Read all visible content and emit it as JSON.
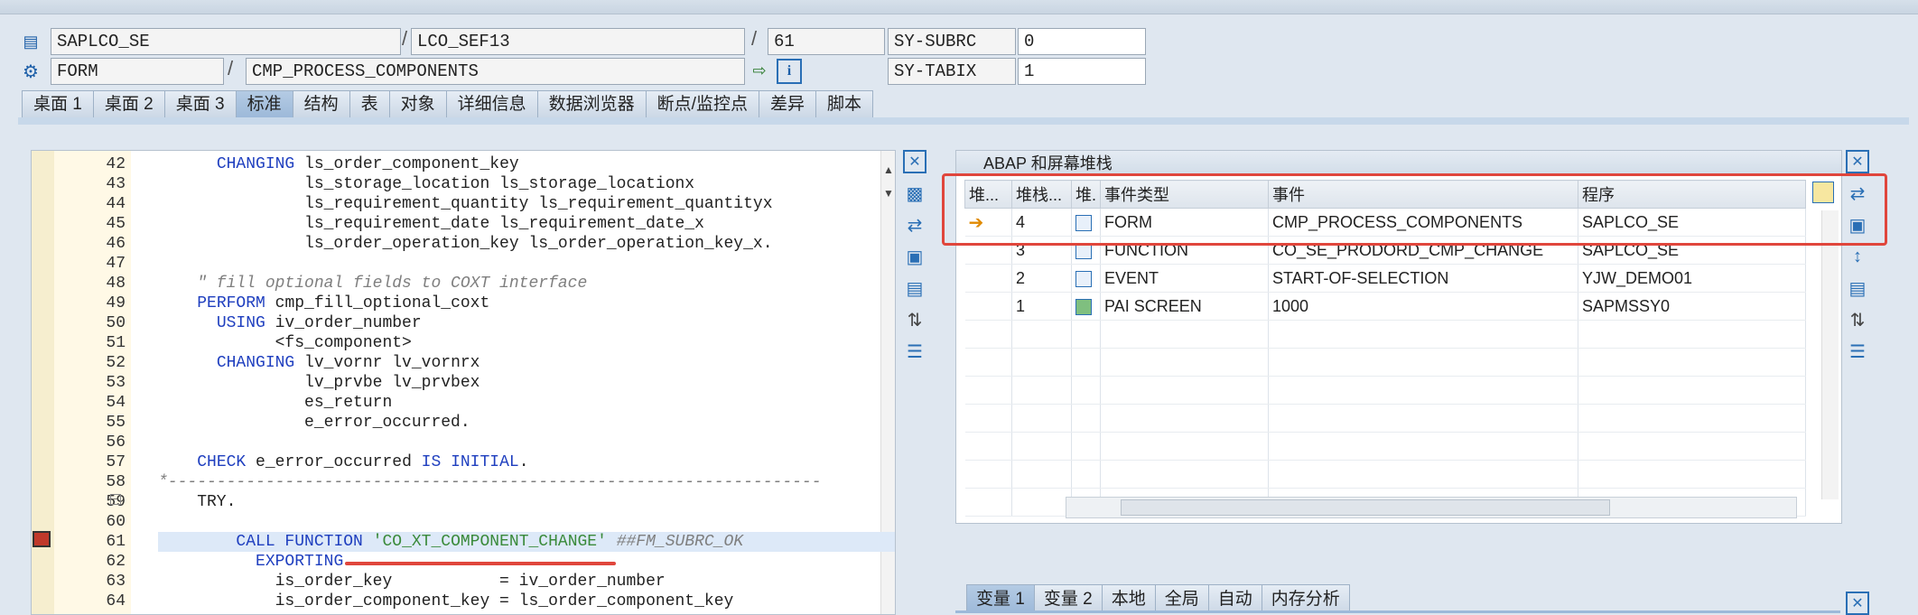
{
  "header": {
    "row1": {
      "program": "SAPLCO_SE",
      "include": "LCO_SEF13",
      "line": "61",
      "sysvar_label": "SY-SUBRC",
      "sysvar_value": "0"
    },
    "row2": {
      "event_type": "FORM",
      "event_name": "CMP_PROCESS_COMPONENTS",
      "sysvar_label": "SY-TABIX",
      "sysvar_value": "1"
    }
  },
  "tabs": [
    "桌面 1",
    "桌面 2",
    "桌面 3",
    "标准",
    "结构",
    "表",
    "对象",
    "详细信息",
    "数据浏览器",
    "断点/监控点",
    "差异",
    "脚本"
  ],
  "active_tab": "标准",
  "editor": {
    "lines": [
      {
        "n": "42",
        "parts": [
          [
            "      ",
            "pl"
          ],
          [
            "CHANGING",
            "kw"
          ],
          [
            " ls_order_component_key",
            "pl"
          ]
        ]
      },
      {
        "n": "43",
        "parts": [
          [
            "               ls_storage_location ls_storage_locationx",
            "pl"
          ]
        ]
      },
      {
        "n": "44",
        "parts": [
          [
            "               ls_requirement_quantity ls_requirement_quantityx",
            "pl"
          ]
        ]
      },
      {
        "n": "45",
        "parts": [
          [
            "               ls_requirement_date ls_requirement_date_x",
            "pl"
          ]
        ]
      },
      {
        "n": "46",
        "parts": [
          [
            "               ls_order_operation_key ls_order_operation_key_x.",
            "pl"
          ]
        ]
      },
      {
        "n": "47",
        "parts": []
      },
      {
        "n": "48",
        "parts": [
          [
            "    \" fill optional fields to COXT interface",
            "cm"
          ]
        ]
      },
      {
        "n": "49",
        "parts": [
          [
            "    ",
            "pl"
          ],
          [
            "PERFORM",
            "kw"
          ],
          [
            " cmp_fill_optional_coxt",
            "pl"
          ]
        ]
      },
      {
        "n": "50",
        "parts": [
          [
            "      ",
            "pl"
          ],
          [
            "USING",
            "kw"
          ],
          [
            " iv_order_number",
            "pl"
          ]
        ]
      },
      {
        "n": "51",
        "parts": [
          [
            "            <fs_component>",
            "pl"
          ]
        ]
      },
      {
        "n": "52",
        "parts": [
          [
            "      ",
            "pl"
          ],
          [
            "CHANGING",
            "kw"
          ],
          [
            " lv_vornr lv_vornrx",
            "pl"
          ]
        ]
      },
      {
        "n": "53",
        "parts": [
          [
            "               lv_prvbe lv_prvbex",
            "pl"
          ]
        ]
      },
      {
        "n": "54",
        "parts": [
          [
            "               es_return",
            "pl"
          ]
        ]
      },
      {
        "n": "55",
        "parts": [
          [
            "               e_error_occurred.",
            "pl"
          ]
        ]
      },
      {
        "n": "56",
        "parts": []
      },
      {
        "n": "57",
        "parts": [
          [
            "    ",
            "pl"
          ],
          [
            "CHECK",
            "kw"
          ],
          [
            " e_error_occurred ",
            "pl"
          ],
          [
            "IS INITIAL",
            "kw"
          ],
          [
            ".",
            "pl"
          ]
        ]
      },
      {
        "n": "58",
        "parts": [
          [
            "*-------------------------------------------------------------------",
            "cm"
          ]
        ]
      },
      {
        "n": "59",
        "parts": [
          [
            "    TRY.",
            "pl"
          ]
        ]
      },
      {
        "n": "60",
        "parts": []
      },
      {
        "n": "61",
        "parts": [
          [
            "        ",
            "pl"
          ],
          [
            "CALL FUNCTION",
            "kw"
          ],
          [
            " 'CO_XT_COMPONENT_CHANGE'",
            "st"
          ],
          [
            " ##FM_SUBRC_OK",
            "cm"
          ]
        ]
      },
      {
        "n": "62",
        "parts": [
          [
            "          ",
            "pl"
          ],
          [
            "EXPORTING",
            "kw"
          ]
        ]
      },
      {
        "n": "63",
        "parts": [
          [
            "            is_order_key           = iv_order_number",
            "pl"
          ]
        ]
      },
      {
        "n": "64",
        "parts": [
          [
            "            is_order_component_key = ls_order_component_key",
            "pl"
          ]
        ]
      }
    ]
  },
  "stack_panel": {
    "title": "ABAP 和屏幕堆栈",
    "columns": [
      "堆...",
      "堆栈...",
      "堆.",
      "事件类型",
      "事件",
      "程序"
    ],
    "rows": [
      {
        "level": "4",
        "type": "FORM",
        "event": "CMP_PROCESS_COMPONENTS",
        "program": "SAPLCO_SE",
        "icon": "abap-icon"
      },
      {
        "level": "3",
        "type": "FUNCTION",
        "event": "CO_SE_PRODORD_CMP_CHANGE",
        "program": "SAPLCO_SE",
        "icon": "abap-icon"
      },
      {
        "level": "2",
        "type": "EVENT",
        "event": "START-OF-SELECTION",
        "program": "YJW_DEMO01",
        "icon": "abap-icon"
      },
      {
        "level": "1",
        "type": "PAI SCREEN",
        "event": "1000",
        "program": "SAPMSSY0",
        "icon": "screen-icon"
      }
    ]
  },
  "bottom_tabs": [
    "变量 1",
    "变量 2",
    "本地",
    "全局",
    "自动",
    "内存分析"
  ],
  "bottom_active": "变量 1",
  "colors": {
    "highlight_border": "#e0463c",
    "keyword": "#1f3fbf",
    "comment": "#7f7f7f",
    "string": "#3a8a3a"
  }
}
